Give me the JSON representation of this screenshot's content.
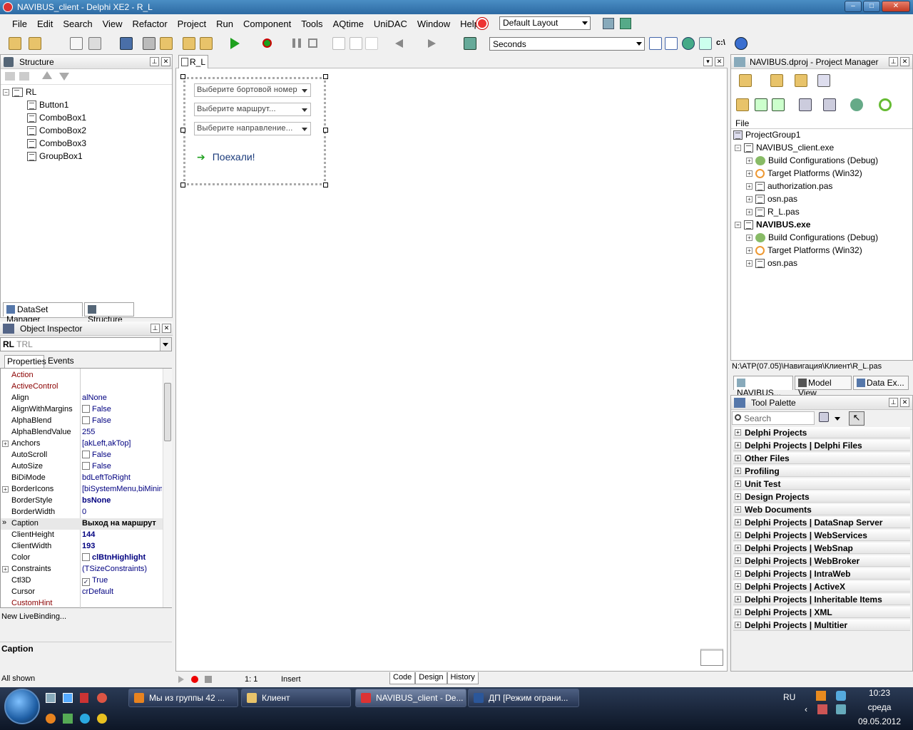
{
  "window": {
    "title": "NAVIBUS_client - Delphi XE2 - R_L"
  },
  "menu": [
    "File",
    "Edit",
    "Search",
    "View",
    "Refactor",
    "Project",
    "Run",
    "Component",
    "Tools",
    "AQtime",
    "UniDAC",
    "Window",
    "Help"
  ],
  "layout_select": "Default Layout",
  "seconds_select": "Seconds",
  "structure": {
    "title": "Structure",
    "root": "RL",
    "children": [
      "Button1",
      "ComboBox1",
      "ComboBox2",
      "ComboBox3",
      "GroupBox1"
    ],
    "tabs": [
      "DataSet Manager",
      "Structure"
    ]
  },
  "inspector": {
    "title": "Object Inspector",
    "object_name": "RL",
    "object_type": "TRL",
    "tabs": [
      "Properties",
      "Events"
    ],
    "rows": [
      {
        "name": "Action",
        "value": "",
        "red": true
      },
      {
        "name": "ActiveControl",
        "value": "",
        "red": true
      },
      {
        "name": "Align",
        "value": "alNone"
      },
      {
        "name": "AlignWithMargins",
        "value": "False",
        "check": ""
      },
      {
        "name": "AlphaBlend",
        "value": "False",
        "check": ""
      },
      {
        "name": "AlphaBlendValue",
        "value": "255"
      },
      {
        "name": "Anchors",
        "value": "[akLeft,akTop]",
        "exp": true
      },
      {
        "name": "AutoScroll",
        "value": "False",
        "check": ""
      },
      {
        "name": "AutoSize",
        "value": "False",
        "check": ""
      },
      {
        "name": "BiDiMode",
        "value": "bdLeftToRight"
      },
      {
        "name": "BorderIcons",
        "value": "[biSystemMenu,biMinim",
        "exp": true
      },
      {
        "name": "BorderStyle",
        "value": "bsNone",
        "bold": true
      },
      {
        "name": "BorderWidth",
        "value": "0"
      },
      {
        "name": "Caption",
        "value": "Выход на маршрут",
        "selected": true,
        "bold": true
      },
      {
        "name": "ClientHeight",
        "value": "144",
        "bold": true
      },
      {
        "name": "ClientWidth",
        "value": "193",
        "bold": true
      },
      {
        "name": "Color",
        "value": "clBtnHighlight",
        "bold": true,
        "swatch": true
      },
      {
        "name": "Constraints",
        "value": "(TSizeConstraints)",
        "exp": true
      },
      {
        "name": "Ctl3D",
        "value": "True",
        "check": "✓"
      },
      {
        "name": "Cursor",
        "value": "crDefault"
      },
      {
        "name": "CustomHint",
        "value": "",
        "red": true
      }
    ],
    "livebinding": "New LiveBinding...",
    "desc_title": "Caption",
    "status": "All shown"
  },
  "designer": {
    "tab": "R_L",
    "combos": [
      "Выберите бортовой  номер",
      "Выберите маршрут...",
      "Выберите направление..."
    ],
    "go_button": "Поехали!",
    "status_pos": "1:  1",
    "status_mode": "Insert",
    "bottom_tabs": [
      "Code",
      "Design",
      "History"
    ]
  },
  "project_manager": {
    "title": "NAVIBUS.dproj - Project Manager",
    "column": "File",
    "items": [
      {
        "label": "ProjectGroup1",
        "level": 0,
        "bold": false
      },
      {
        "label": "NAVIBUS_client.exe",
        "level": 1,
        "bold": false
      },
      {
        "label": "Build Configurations (Debug)",
        "level": 2
      },
      {
        "label": "Target Platforms (Win32)",
        "level": 2
      },
      {
        "label": "authorization.pas",
        "level": 2
      },
      {
        "label": "osn.pas",
        "level": 2
      },
      {
        "label": "R_L.pas",
        "level": 2
      },
      {
        "label": "NAVIBUS.exe",
        "level": 1,
        "bold": true
      },
      {
        "label": "Build Configurations (Debug)",
        "level": 2
      },
      {
        "label": "Target Platforms (Win32)",
        "level": 2
      },
      {
        "label": "osn.pas",
        "level": 2
      }
    ],
    "path": "N:\\ATP(07.05)\\Навигация\\Клиент\\R_L.pas",
    "tabs": [
      "NAVIBUS...",
      "Model View",
      "Data Ex..."
    ]
  },
  "tool_palette": {
    "title": "Tool Palette",
    "search_placeholder": "Search",
    "categories": [
      "Delphi Projects",
      "Delphi Projects | Delphi Files",
      "Other Files",
      "Profiling",
      "Unit Test",
      "Design Projects",
      "Web Documents",
      "Delphi Projects | DataSnap Server",
      "Delphi Projects | WebServices",
      "Delphi Projects | WebSnap",
      "Delphi Projects | WebBroker",
      "Delphi Projects | IntraWeb",
      "Delphi Projects | ActiveX",
      "Delphi Projects | Inheritable Items",
      "Delphi Projects | XML",
      "Delphi Projects | Multitier"
    ]
  },
  "taskbar": {
    "buttons": [
      "Мы из группы 42 ...",
      "Клиент",
      "NAVIBUS_client - De...",
      "ДП [Режим ограни..."
    ],
    "lang": "RU",
    "time": "10:23",
    "day": "среда",
    "date": "09.05.2012"
  }
}
